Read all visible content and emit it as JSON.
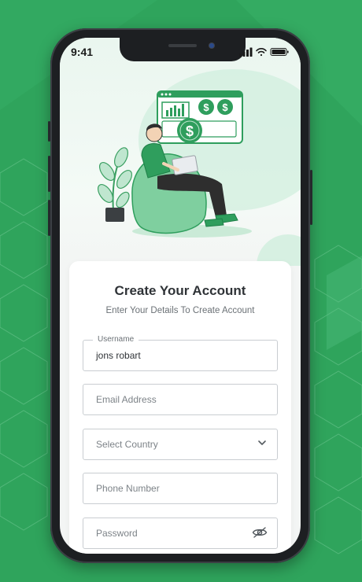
{
  "status_bar": {
    "time": "9:41"
  },
  "form": {
    "title": "Create Your Account",
    "subtitle": "Enter Your Details To Create Account",
    "username": {
      "label": "Username",
      "value": "jons robart"
    },
    "email": {
      "placeholder": "Email Address"
    },
    "country": {
      "placeholder": "Select Country"
    },
    "phone": {
      "placeholder": "Phone Number"
    },
    "password": {
      "placeholder": "Password"
    }
  },
  "colors": {
    "background": "#2fa45c",
    "accent": "#3dbb6e",
    "text_dark": "#2f3337",
    "text_muted": "#7d8388"
  },
  "icons": [
    "signal-icon",
    "wifi-icon",
    "battery-icon",
    "chevron-down-icon",
    "eye-off-icon"
  ]
}
